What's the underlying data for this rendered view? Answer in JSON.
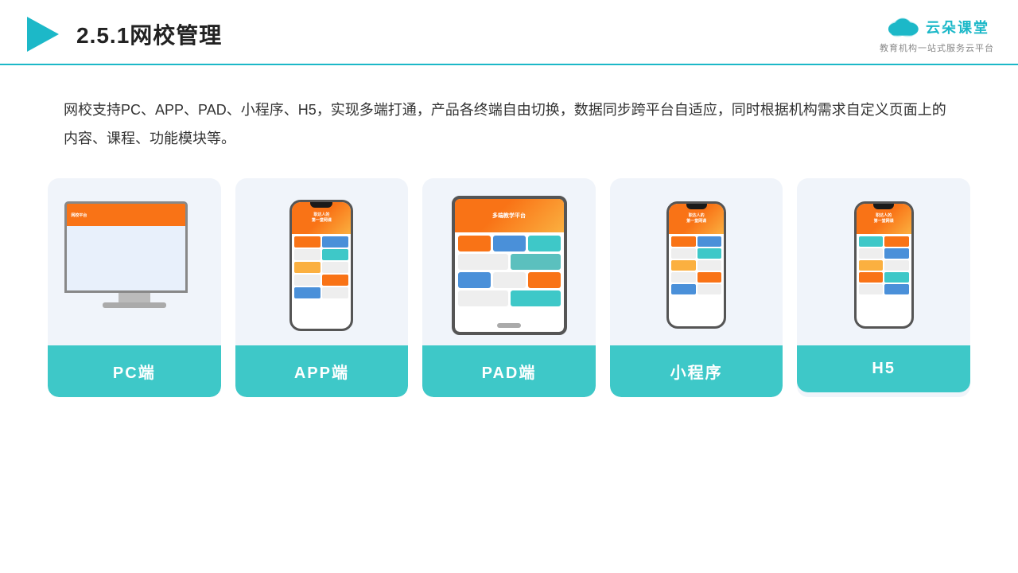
{
  "header": {
    "title": "2.5.1网校管理",
    "logo_text": "云朵课堂",
    "logo_url": "yunduoketang.com",
    "logo_sub": "教育机构一站式服务云平台"
  },
  "description": {
    "text": "网校支持PC、APP、PAD、小程序、H5，实现多端打通，产品各终端自由切换，数据同步跨平台自适应，同时根据机构需求自定义页面上的内容、课程、功能模块等。"
  },
  "cards": [
    {
      "label": "PC端",
      "id": "pc"
    },
    {
      "label": "APP端",
      "id": "app"
    },
    {
      "label": "PAD端",
      "id": "pad"
    },
    {
      "label": "小程序",
      "id": "mini"
    },
    {
      "label": "H5",
      "id": "h5"
    }
  ],
  "colors": {
    "accent": "#3ec8c8",
    "header_line": "#1cb8c8",
    "orange": "#f97316",
    "blue": "#4a90d9"
  }
}
